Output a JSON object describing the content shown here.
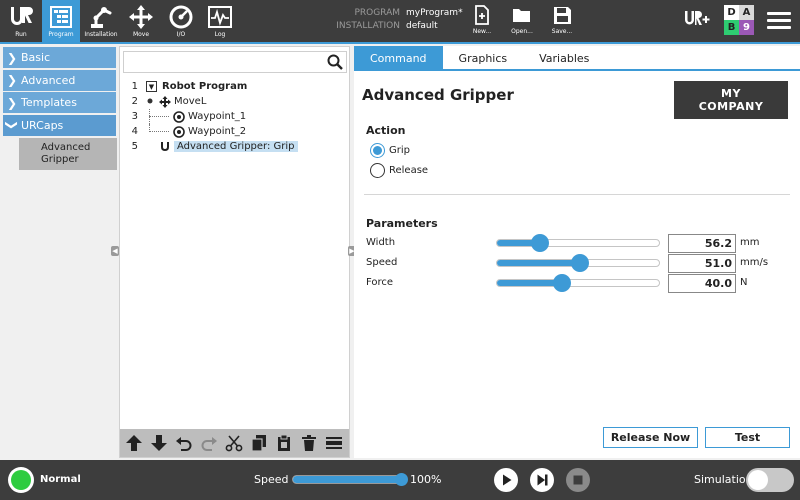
{
  "topbar": {
    "nav": [
      {
        "label": "Run",
        "icon": "ur-logo-icon"
      },
      {
        "label": "Program",
        "icon": "program-tree-icon",
        "active": true
      },
      {
        "label": "Installation",
        "icon": "robot-arm-icon"
      },
      {
        "label": "Move",
        "icon": "move-arrows-icon"
      },
      {
        "label": "I/O",
        "icon": "io-gauge-icon"
      },
      {
        "label": "Log",
        "icon": "log-chart-icon"
      }
    ],
    "program_key": "PROGRAM",
    "program_value": "myProgram*",
    "installation_key": "INSTALLATION",
    "installation_value": "default",
    "file_buttons": [
      {
        "label": "New...",
        "icon": "new-file-icon"
      },
      {
        "label": "Open...",
        "icon": "open-folder-icon"
      },
      {
        "label": "Save...",
        "icon": "save-disk-icon"
      }
    ],
    "dab": {
      "d": "D",
      "a": "A",
      "b": "B",
      "n": "9"
    }
  },
  "leftnav": {
    "items": [
      {
        "label": "Basic",
        "expanded": false
      },
      {
        "label": "Advanced",
        "expanded": false
      },
      {
        "label": "Templates",
        "expanded": false
      },
      {
        "label": "URCaps",
        "expanded": true
      }
    ],
    "sub_item": "Advanced Gripper"
  },
  "tree": {
    "search_placeholder": "",
    "lines": [
      {
        "num": "1",
        "text": "Robot Program"
      },
      {
        "num": "2",
        "text": "MoveL"
      },
      {
        "num": "3",
        "text": "Waypoint_1"
      },
      {
        "num": "4",
        "text": "Waypoint_2"
      },
      {
        "num": "5",
        "text": "Advanced Gripper: Grip",
        "selected": true
      }
    ]
  },
  "tabs": [
    {
      "label": "Command",
      "active": true
    },
    {
      "label": "Graphics"
    },
    {
      "label": "Variables"
    }
  ],
  "gripper": {
    "title": "Advanced Gripper",
    "logo": "MY COMPANY",
    "action_title": "Action",
    "actions": [
      {
        "label": "Grip",
        "checked": true
      },
      {
        "label": "Release",
        "checked": false
      }
    ],
    "params_title": "Parameters",
    "params": [
      {
        "label": "Width",
        "value": "56.2",
        "unit": "mm",
        "fraction": 0.27
      },
      {
        "label": "Speed",
        "value": "51.0",
        "unit": "mm/s",
        "fraction": 0.51
      },
      {
        "label": "Force",
        "value": "40.0",
        "unit": "N",
        "fraction": 0.4
      }
    ],
    "release_now": "Release Now",
    "test": "Test"
  },
  "footer": {
    "status": "Normal",
    "speed_label": "Speed",
    "speed_value": "100%",
    "speed_fraction": 1.0,
    "simulation_label": "Simulation",
    "simulation_on": false
  },
  "colors": {
    "accent": "#3d9ad6",
    "menu": "#6ca8d8",
    "topbar": "#3d3d3d",
    "status_ok": "#2ecc40"
  }
}
